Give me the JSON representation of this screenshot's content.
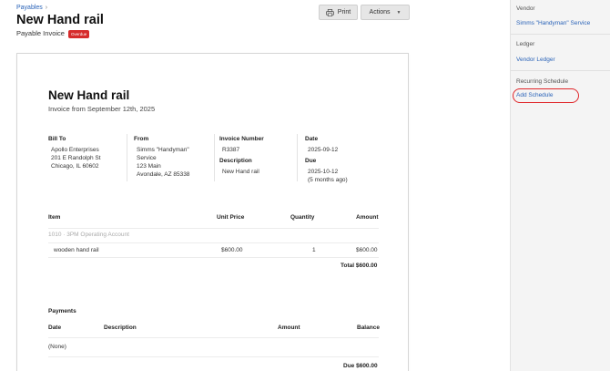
{
  "breadcrumb": {
    "parent": "Payables",
    "separator": "›"
  },
  "page": {
    "title": "New Hand rail",
    "subtitle": "Payable Invoice",
    "status_badge": "Overdue"
  },
  "toolbar": {
    "print_label": "Print",
    "actions_label": "Actions"
  },
  "invoice": {
    "title": "New Hand rail",
    "subtitle": "Invoice from September 12th, 2025",
    "bill_to": {
      "label": "Bill To",
      "name": "Apollo Enterprises",
      "address1": "201 E Randolph St",
      "address2": "Chicago, IL 60602"
    },
    "from": {
      "label": "From",
      "name_line1": "Simms \"Handyman\"",
      "name_line2": "Service",
      "address1": "123 Main",
      "address2": "Avondale, AZ 85338"
    },
    "invoice_number": {
      "label": "Invoice Number",
      "value": "R3387"
    },
    "description": {
      "label": "Description",
      "value": "New Hand rail"
    },
    "date": {
      "label": "Date",
      "value": "2025-09-12"
    },
    "due": {
      "label": "Due",
      "value": "2025-10-12",
      "relative": "(5 months ago)"
    },
    "items_table": {
      "headers": {
        "item": "Item",
        "unit_price": "Unit Price",
        "quantity": "Quantity",
        "amount": "Amount"
      },
      "account_row": "1010 · 3PM Operating Account",
      "rows": [
        {
          "item": "wooden hand rail",
          "unit_price": "$600.00",
          "quantity": "1",
          "amount": "$600.00"
        }
      ],
      "total": "Total $600.00"
    },
    "payments": {
      "label": "Payments",
      "headers": {
        "date": "Date",
        "description": "Description",
        "amount": "Amount",
        "balance": "Balance"
      },
      "empty": "(None)",
      "due": "Due $600.00"
    }
  },
  "sidebar": {
    "vendor": {
      "label": "Vendor",
      "link": "Simms \"Handyman\" Service"
    },
    "ledger": {
      "label": "Ledger",
      "link": "Vendor Ledger"
    },
    "recurring": {
      "label": "Recurring Schedule",
      "link": "Add Schedule"
    },
    "highlight_color": "#e0262a"
  },
  "icons": {
    "print": "printer-icon",
    "actions": "chevron-down-icon"
  }
}
